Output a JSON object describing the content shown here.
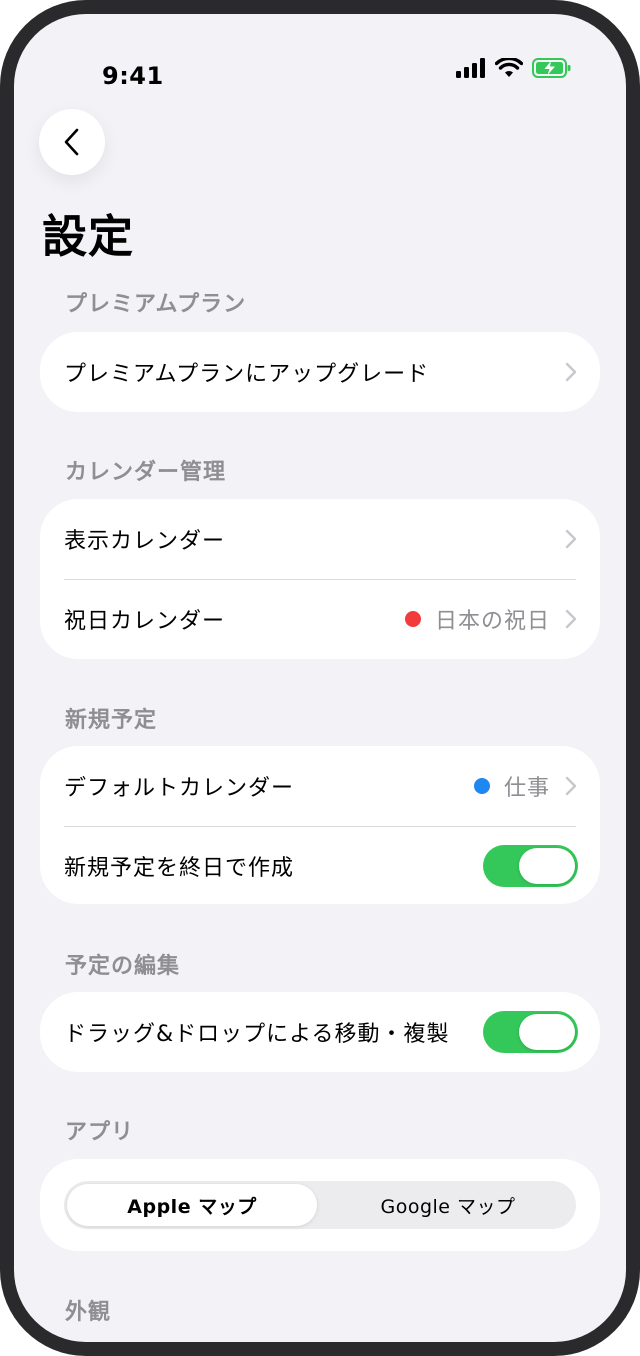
{
  "status_bar": {
    "time": "9:41"
  },
  "page_title": "設定",
  "sections": {
    "premium": {
      "header": "プレミアムプラン",
      "rows": [
        {
          "label": "プレミアムプランにアップグレード"
        }
      ]
    },
    "calendar": {
      "header": "カレンダー管理",
      "rows": [
        {
          "label": "表示カレンダー"
        },
        {
          "label": "祝日カレンダー",
          "value": "日本の祝日",
          "dot_color": "#f23c3c"
        }
      ]
    },
    "new_event": {
      "header": "新規予定",
      "rows": [
        {
          "label": "デフォルトカレンダー",
          "value": "仕事",
          "dot_color": "#1e88f0"
        },
        {
          "label": "新規予定を終日で作成",
          "toggle_on": true
        }
      ]
    },
    "editing": {
      "header": "予定の編集",
      "rows": [
        {
          "label": "ドラッグ&ドロップによる移動・複製",
          "toggle_on": true
        }
      ]
    },
    "app": {
      "header": "アプリ",
      "segments": [
        {
          "label": "Apple マップ",
          "selected": true
        },
        {
          "label": "Google マップ",
          "selected": false
        }
      ]
    },
    "appearance": {
      "header": "外観"
    }
  },
  "colors": {
    "toggle_on": "#34c759",
    "background": "#f2f2f7",
    "secondary_text": "#8e8e93"
  },
  "icons": [
    "signal-icon",
    "wifi-icon",
    "battery-charging-icon",
    "back-chevron-icon",
    "chevron-right-icon"
  ]
}
